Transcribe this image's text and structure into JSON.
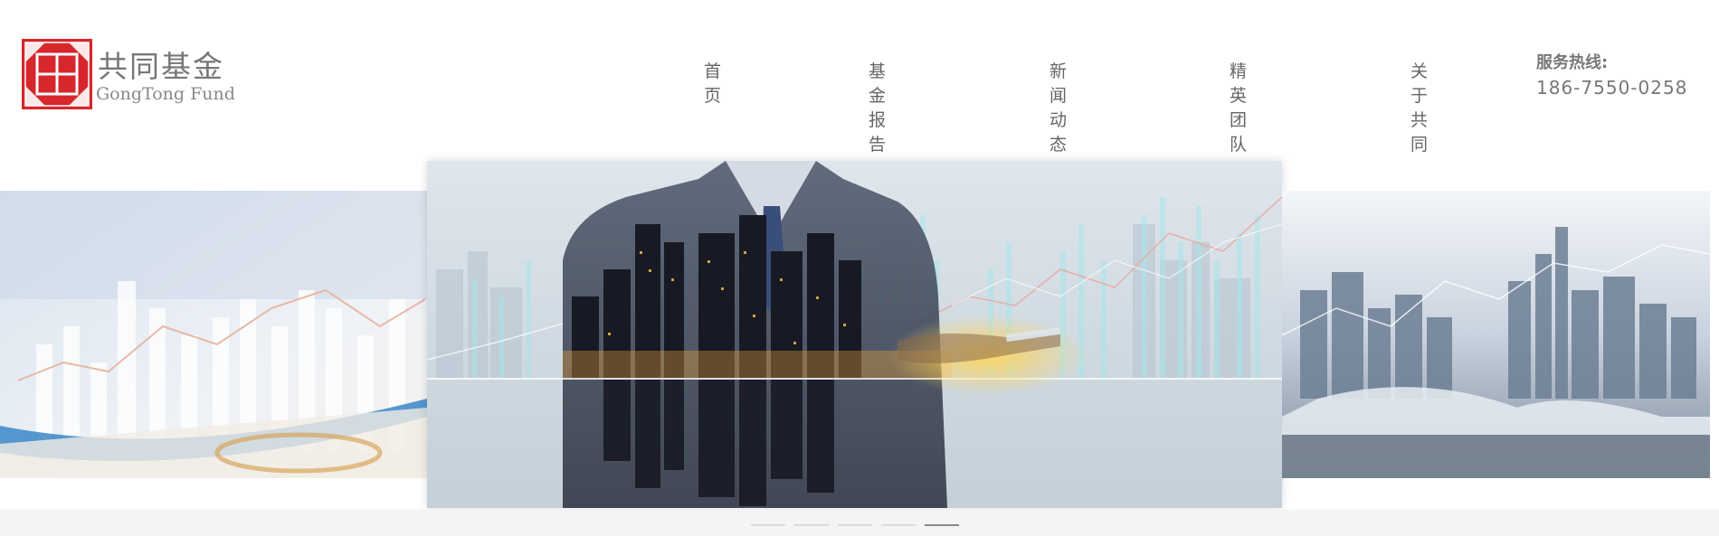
{
  "brand": {
    "name_cn": "共同基金",
    "name_en": "GongTong Fund",
    "logo_color": "#d7262c"
  },
  "nav": {
    "items": [
      {
        "label": "首页"
      },
      {
        "label": "基金报告"
      },
      {
        "label": "新闻动态"
      },
      {
        "label": "精英团队"
      },
      {
        "label": "关于共同"
      }
    ]
  },
  "hotline": {
    "label": "服务热线:",
    "number": "186-7550-0258"
  },
  "banner": {
    "slide_count": 5,
    "active_slide": 5
  }
}
